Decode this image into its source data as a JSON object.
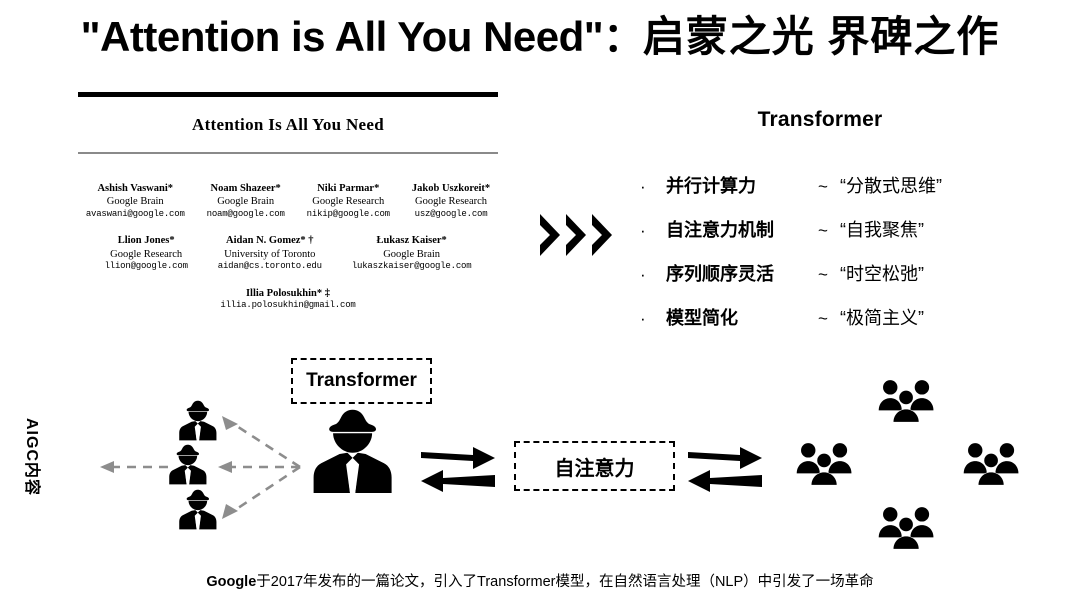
{
  "title": {
    "english": "\"Attention is All You Need\"",
    "colon": "：",
    "chinese": "启蒙之光  界碑之作"
  },
  "paper": {
    "title": "Attention Is All You Need",
    "author_rows": [
      [
        {
          "name": "Ashish Vaswani*",
          "affiliation": "Google Brain",
          "email": "avaswani@google.com"
        },
        {
          "name": "Noam Shazeer*",
          "affiliation": "Google Brain",
          "email": "noam@google.com"
        },
        {
          "name": "Niki Parmar*",
          "affiliation": "Google Research",
          "email": "nikip@google.com"
        },
        {
          "name": "Jakob Uszkoreit*",
          "affiliation": "Google Research",
          "email": "usz@google.com"
        }
      ],
      [
        {
          "name": "Llion Jones*",
          "affiliation": "Google Research",
          "email": "llion@google.com"
        },
        {
          "name": "Aidan N. Gomez* †",
          "affiliation": "University of Toronto",
          "email": "aidan@cs.toronto.edu"
        },
        {
          "name": "Łukasz Kaiser*",
          "affiliation": "Google Brain",
          "email": "lukaszkaiser@google.com"
        }
      ],
      [
        {
          "name": "Illia Polosukhin* ‡",
          "affiliation": "",
          "email": "illia.polosukhin@gmail.com"
        }
      ]
    ]
  },
  "right_panel": {
    "heading": "Transformer",
    "bullets": [
      {
        "marker": "·",
        "key": "并行计算力",
        "tilde": "~",
        "value": "“分散式思维”"
      },
      {
        "marker": "·",
        "key": "自注意力机制",
        "tilde": "~",
        "value": "“自我聚焦”"
      },
      {
        "marker": "·",
        "key": "序列顺序灵活",
        "tilde": "~",
        "value": "“时空松弛”"
      },
      {
        "marker": "·",
        "key": "模型简化",
        "tilde": "~",
        "value": "“极简主义”"
      }
    ]
  },
  "diagram": {
    "transformer_box": "Transformer",
    "attention_box": "自注意力",
    "vertical_label": "AIGC内容",
    "chevron_count": 3,
    "agent_icons": 3,
    "group_icons": 4
  },
  "caption": {
    "bold_prefix": "Google",
    "rest": "于2017年发布的一篇论文，引入了Transformer模型，在自然语言处理（NLP）中引发了一场革命"
  },
  "colors": {
    "ink": "#000000",
    "rule_gray": "#8a8a8a",
    "dashed_arrow": "#8d8d8d",
    "background": "#ffffff"
  }
}
